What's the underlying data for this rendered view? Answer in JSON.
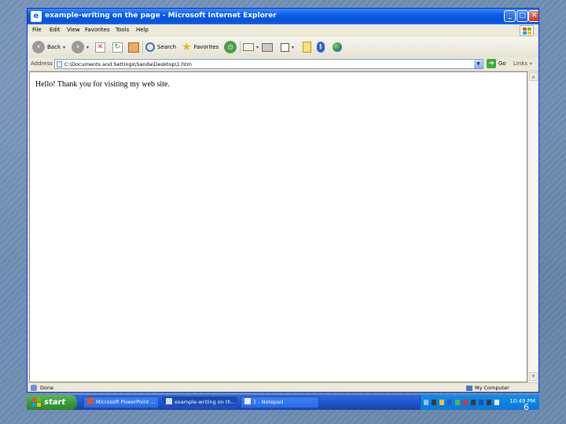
{
  "window": {
    "title": "example-writing on the page - Microsoft Internet Explorer",
    "controls": {
      "minimize": "_",
      "maximize": "□",
      "close": "✕"
    }
  },
  "menu": [
    "File",
    "Edit",
    "View",
    "Favorites",
    "Tools",
    "Help"
  ],
  "toolbar": {
    "back_label": "Back",
    "search_label": "Search",
    "favorites_label": "Favorites"
  },
  "address": {
    "label": "Address",
    "value": "C:\\Documents and Settings\\Sanda\\Desktop\\1.htm",
    "go_label": "Go",
    "links_label": "Links"
  },
  "page": {
    "body_text": "Hello! Thank you for visiting my web site."
  },
  "status": {
    "text": "Done",
    "zone": "My Computer"
  },
  "taskbar": {
    "start_label": "start",
    "tasks": [
      {
        "label": "Microsoft PowerPoint ..."
      },
      {
        "label": "example-writing on th..."
      },
      {
        "label": "1 - Notepad"
      }
    ],
    "clock": "10:49 PM"
  },
  "slide_number": "6",
  "colors": {
    "titlebar": "#0a5ce6",
    "taskbar": "#245edb",
    "start_button": "#3a9c3a",
    "tray": "#0b77d8",
    "desktop": "#6f8fb4"
  }
}
